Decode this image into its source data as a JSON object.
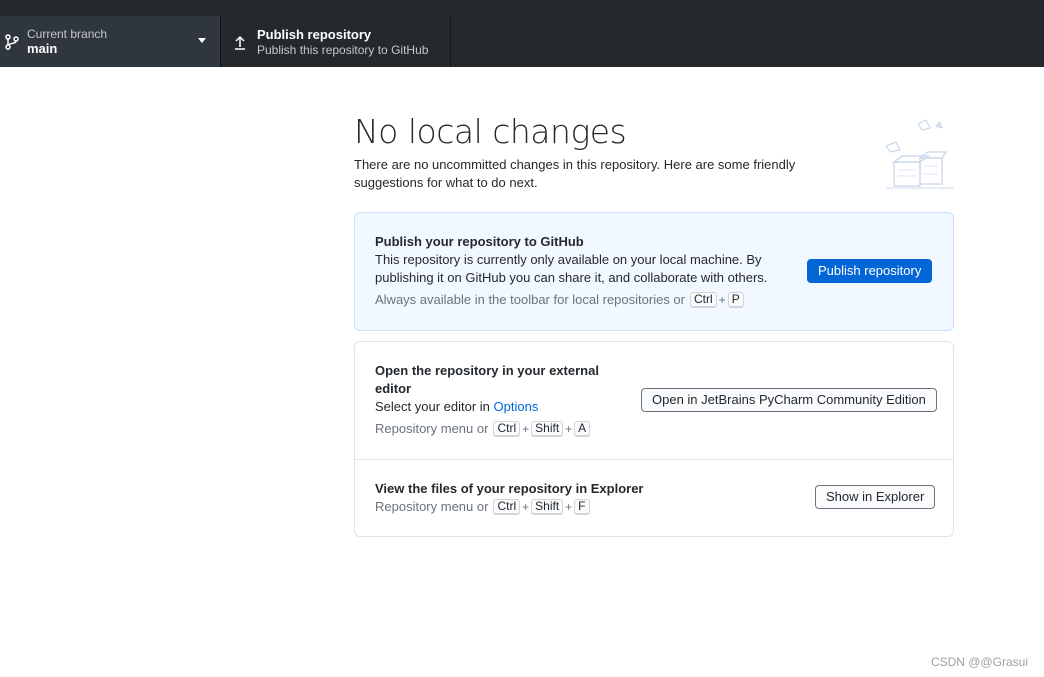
{
  "toolbar": {
    "branch_caption": "Current branch",
    "branch_name": "main",
    "publish_title": "Publish repository",
    "publish_caption": "Publish this repository to GitHub"
  },
  "main": {
    "title": "No local changes",
    "subtitle": "There are no uncommitted changes in this repository. Here are some friendly suggestions for what to do next."
  },
  "publish_card": {
    "title": "Publish your repository to GitHub",
    "text": "This repository is currently only available on your local machine. By publishing it on GitHub you can share it, and collaborate with others.",
    "hint": "Always available in the toolbar for local repositories or",
    "keys": [
      "Ctrl",
      "P"
    ],
    "button": "Publish repository"
  },
  "editor_section": {
    "title": "Open the repository in your external editor",
    "text_prefix": "Select your editor in",
    "link": "Options",
    "hint": "Repository menu or",
    "keys": [
      "Ctrl",
      "Shift",
      "A"
    ],
    "button": "Open in JetBrains PyCharm Community Edition"
  },
  "explorer_section": {
    "title": "View the files of your repository in Explorer",
    "hint": "Repository menu or",
    "keys": [
      "Ctrl",
      "Shift",
      "F"
    ],
    "button": "Show in Explorer"
  },
  "watermark": "CSDN @@Grasui",
  "colors": {
    "toolbar_bg": "#24292e",
    "branch_bg": "#2f363d",
    "primary": "#0366d6",
    "card_blue": "#f1f8ff"
  },
  "icons": [
    "git-branch-icon",
    "caret-down-icon",
    "upload-icon",
    "empty-state-illustration"
  ]
}
